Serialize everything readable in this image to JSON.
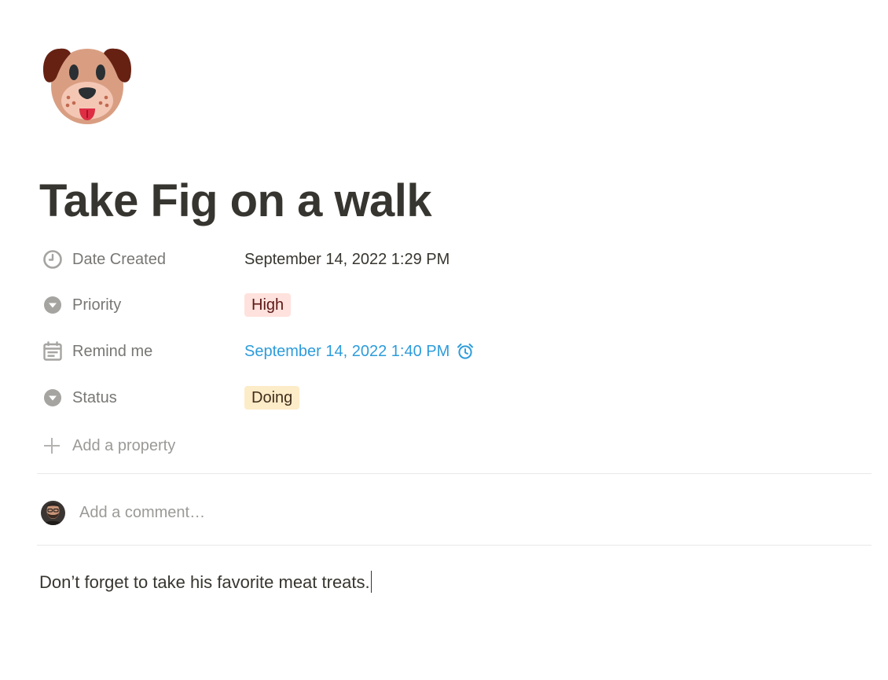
{
  "page": {
    "icon": "dog-face-icon",
    "title": "Take Fig on a walk"
  },
  "properties": [
    {
      "icon": "clock-icon",
      "name": "Date Created",
      "value": "September 14, 2022 1:29 PM"
    },
    {
      "icon": "select-icon",
      "name": "Priority",
      "value": "High",
      "tag_color": "#ffe2dd"
    },
    {
      "icon": "calendar-icon",
      "name": "Remind me",
      "value": "September 14, 2022 1:40 PM",
      "value_color": "#2d9cdb",
      "trailing_icon": "alarm-clock-icon"
    },
    {
      "icon": "select-icon",
      "name": "Status",
      "value": "Doing",
      "tag_color": "#fdecc8"
    }
  ],
  "add_property": {
    "icon": "plus-icon",
    "label": "Add a property"
  },
  "comments": {
    "avatar": "avatar",
    "placeholder": "Add a comment…"
  },
  "body": {
    "text": "Don’t forget to take his favorite meat treats."
  }
}
